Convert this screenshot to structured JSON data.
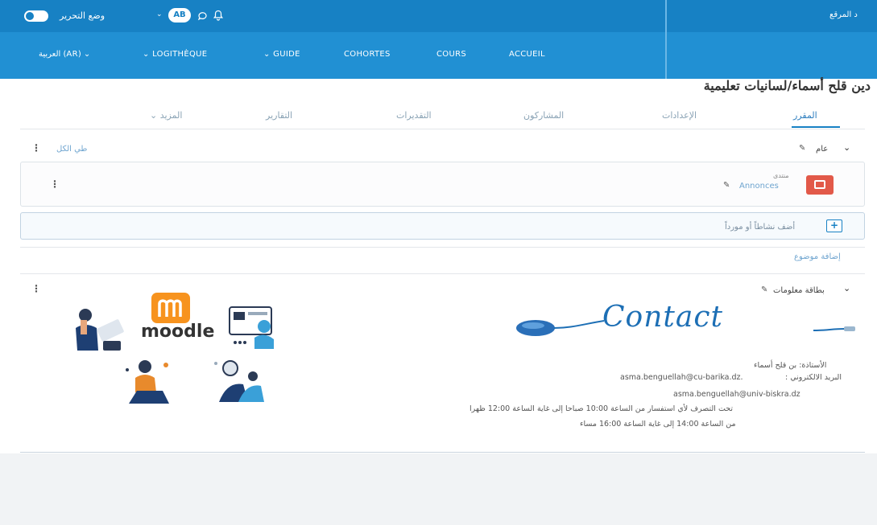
{
  "topbar": {
    "edit_mode_label": "وضع التحرير",
    "avatar_initials": "AB",
    "right_text": "د المرقع"
  },
  "nav": {
    "language": "العربية (AR) ⌄",
    "logitheque": "⌄ LOGITHÈQUE",
    "guide": "⌄ GUIDE",
    "cohortes": "COHORTES",
    "cours": "COURS",
    "accueil": "ACCUEIL"
  },
  "course": {
    "title": "دين قلح أسماء/لسانيات تعليمية"
  },
  "tabs": {
    "course": "المقرر",
    "settings": "الإعدادات",
    "participants": "المشاركون",
    "grades": "التقديرات",
    "reports": "التقارير",
    "more": "المزيد ⌄"
  },
  "sections": {
    "collapse_all": "طي الكل",
    "general_title": "عام",
    "forum_type": "منتدى",
    "forum_name": "Annonces",
    "add_activity": "أضف نشاطاً أو مورداً",
    "add_topic": "إضافة موضوع",
    "info_card_title": "بطاقة معلومات"
  },
  "info_card": {
    "contact_word": "Contact",
    "teacher": "الأستاذة: بن قلح أسماء",
    "email_label": "البريد الالكتروني :",
    "email_1": "asma.benguellah@cu-barika.dz.",
    "email_2": "asma.benguellah@univ-biskra.dz",
    "hours_line_1": "تحت التصرف لأي استفسار من الساعة 10:00 صباحا إلى غاية الساعة 12:00 ظهرا",
    "hours_line_2": "من الساعة 14:00 إلى غاية الساعة 16:00 مساء"
  },
  "moodle_logo_text": "moodle",
  "colors": {
    "brand": "#1781c4",
    "nav": "#2190d3",
    "forum_icon": "#e25949",
    "moodle_orange": "#f7931e"
  }
}
